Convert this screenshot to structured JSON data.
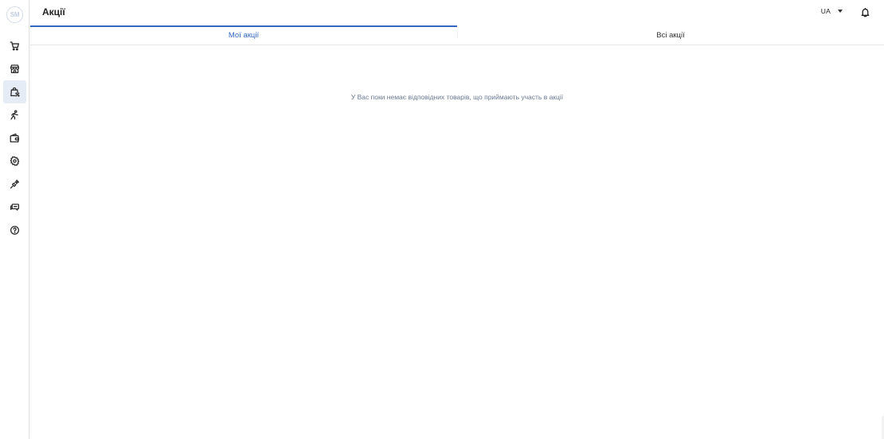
{
  "app": {
    "logo_text": "SM"
  },
  "header": {
    "title": "Акції",
    "language": "UA"
  },
  "sidebar": {
    "items": [
      {
        "name": "cart",
        "icon": "cart-icon",
        "active": false
      },
      {
        "name": "store",
        "icon": "store-icon",
        "active": false
      },
      {
        "name": "promotions",
        "icon": "shopping-bag-percent-icon",
        "active": true
      },
      {
        "name": "delivery",
        "icon": "courier-icon",
        "active": false
      },
      {
        "name": "wallet",
        "icon": "wallet-icon",
        "active": false
      },
      {
        "name": "settings",
        "icon": "gear-icon",
        "active": false
      },
      {
        "name": "integrations",
        "icon": "plug-icon",
        "active": false
      },
      {
        "name": "messages",
        "icon": "chat-icon",
        "active": false
      },
      {
        "name": "help",
        "icon": "help-icon",
        "active": false
      }
    ]
  },
  "tabs": [
    {
      "label": "Мої акції",
      "active": true
    },
    {
      "label": "Всі акції",
      "active": false
    }
  ],
  "main": {
    "empty_message": "У Вас поки немає відповідних товарів, що приймають участь в акції"
  },
  "colors": {
    "accent": "#3467c4",
    "active_nav_bg": "#e6ecf6",
    "empty_text": "#6d7a94"
  }
}
